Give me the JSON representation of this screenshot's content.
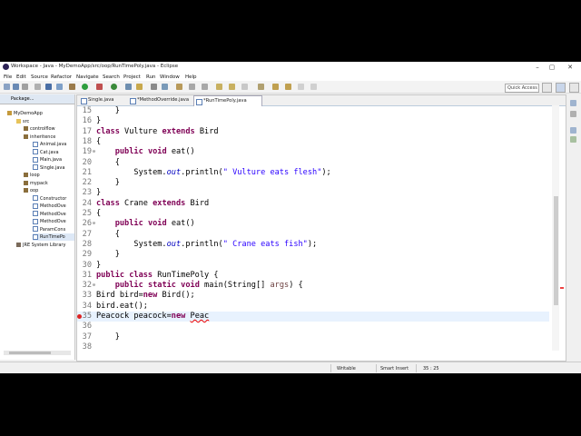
{
  "window": {
    "title": "Workspace - Java - MyDemoApp/src/oop/RunTimePoly.java - Eclipse",
    "controls": {
      "minimize": "–",
      "maximize": "▢",
      "close": "✕"
    }
  },
  "menubar": [
    "File",
    "Edit",
    "Source",
    "Refactor",
    "Navigate",
    "Search",
    "Project",
    "Run",
    "Window",
    "Help"
  ],
  "quick_access": {
    "placeholder": "Quick Access"
  },
  "package_explorer": {
    "tab_label": "Package...",
    "tree": [
      {
        "label": "MyDemoApp",
        "icon": "project-icon"
      },
      {
        "label": "src",
        "icon": "source-folder-icon"
      },
      {
        "label": "controlflow",
        "icon": "package-icon"
      },
      {
        "label": "inheritence",
        "icon": "package-icon"
      },
      {
        "label": "Animal.java",
        "icon": "java-file-icon"
      },
      {
        "label": "Cat.java",
        "icon": "java-file-icon"
      },
      {
        "label": "Main.java",
        "icon": "java-file-icon"
      },
      {
        "label": "Single.java",
        "icon": "java-file-icon"
      },
      {
        "label": "loop",
        "icon": "package-icon"
      },
      {
        "label": "mypack",
        "icon": "package-icon"
      },
      {
        "label": "oop",
        "icon": "package-icon"
      },
      {
        "label": "Constructor",
        "icon": "java-file-icon"
      },
      {
        "label": "MethodOve",
        "icon": "java-file-icon"
      },
      {
        "label": "MethodOve",
        "icon": "java-file-icon"
      },
      {
        "label": "MethodOve",
        "icon": "java-file-icon"
      },
      {
        "label": "ParamCons",
        "icon": "java-file-icon"
      },
      {
        "label": "RunTimePo",
        "icon": "java-file-icon"
      },
      {
        "label": "JRE System Library",
        "icon": "library-icon"
      }
    ]
  },
  "editor": {
    "tabs": [
      {
        "label": "Single.java"
      },
      {
        "label": "*MethodOverride.java"
      },
      {
        "label": "*RunTimePoly.java"
      }
    ],
    "lines": [
      {
        "n": "15",
        "text": "    }"
      },
      {
        "n": "16",
        "text": "}"
      },
      {
        "n": "17",
        "text": "class Vulture extends Bird"
      },
      {
        "n": "18",
        "text": "{"
      },
      {
        "n": "19",
        "text": "    public void eat()"
      },
      {
        "n": "20",
        "text": "    {"
      },
      {
        "n": "21",
        "text": "        System.out.println(\" Vulture eats flesh\");"
      },
      {
        "n": "22",
        "text": "    }"
      },
      {
        "n": "23",
        "text": "}"
      },
      {
        "n": "24",
        "text": "class Crane extends Bird"
      },
      {
        "n": "25",
        "text": "{"
      },
      {
        "n": "26",
        "text": "    public void eat()"
      },
      {
        "n": "27",
        "text": "    {"
      },
      {
        "n": "28",
        "text": "        System.out.println(\" Crane eats fish\");"
      },
      {
        "n": "29",
        "text": "    }"
      },
      {
        "n": "30",
        "text": "}"
      },
      {
        "n": "31",
        "text": "public class RunTimePoly {"
      },
      {
        "n": "32",
        "text": "    public static void main(String[] args) {"
      },
      {
        "n": "33",
        "text": "Bird bird=new Bird();"
      },
      {
        "n": "34",
        "text": "bird.eat();"
      },
      {
        "n": "35",
        "text": "Peacock peacock=new Peac"
      },
      {
        "n": "36",
        "text": ""
      },
      {
        "n": "37",
        "text": "    }"
      },
      {
        "n": "38",
        "text": ""
      }
    ]
  },
  "status": {
    "writable": "Writable",
    "insert_mode": "Smart Insert",
    "position": "35 : 25"
  },
  "colors": {
    "keyword": "#7f0055",
    "string": "#2a00ff",
    "static_field": "#0000c0",
    "param": "#6a3e3e",
    "current_line": "#e8f2fe",
    "error": "#e00000"
  }
}
